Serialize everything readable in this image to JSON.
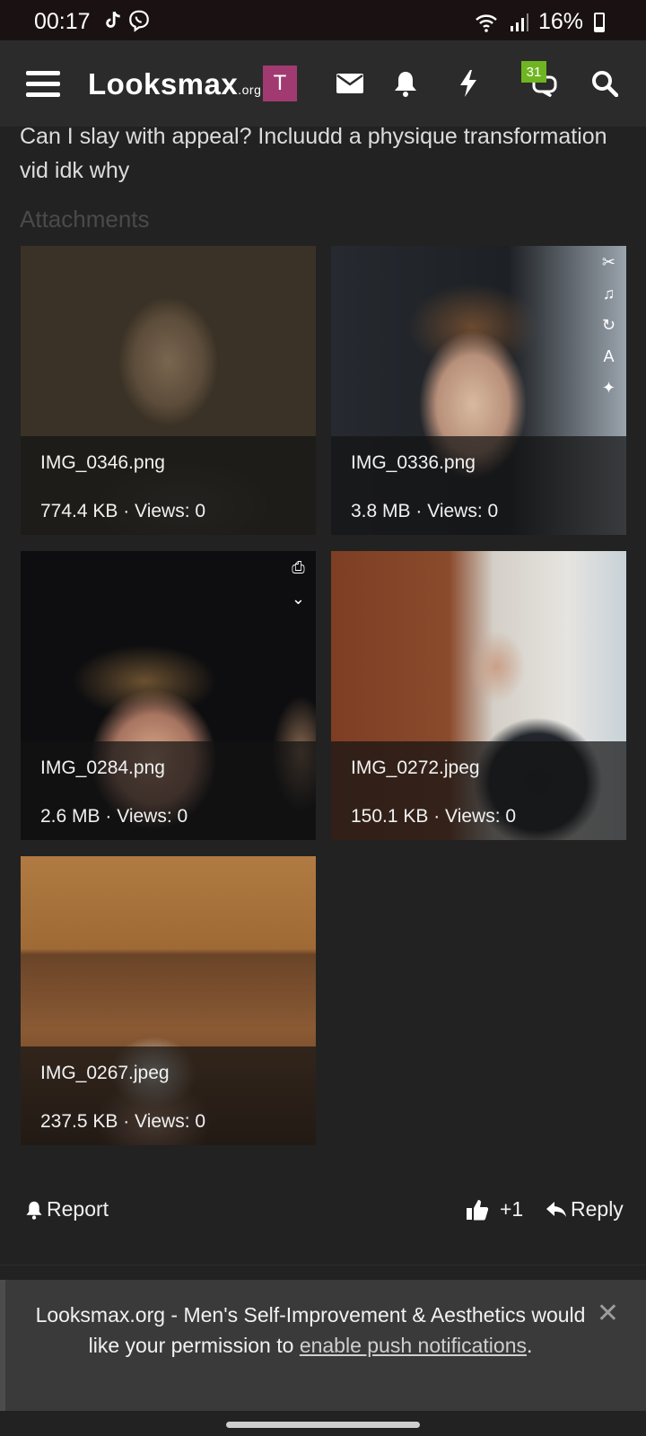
{
  "status": {
    "time": "00:17",
    "battery": "16%"
  },
  "nav": {
    "brand": "Looksmax",
    "brand_suffix": ".org",
    "avatar_letter": "T",
    "badge_count": "31"
  },
  "post": {
    "text": "Can I slay with appeal? Incluudd a physique transformation vid idk why",
    "attachments_label": "Attachments"
  },
  "attachments": [
    {
      "name": "IMG_0346.png",
      "meta": "774.4 KB · Views: 0"
    },
    {
      "name": "IMG_0336.png",
      "meta": "3.8 MB · Views: 0"
    },
    {
      "name": "IMG_0284.png",
      "meta": "2.6 MB · Views: 0"
    },
    {
      "name": "IMG_0272.jpeg",
      "meta": "150.1 KB · Views: 0"
    },
    {
      "name": "IMG_0267.jpeg",
      "meta": "237.5 KB · Views: 0"
    }
  ],
  "actions": {
    "report": "Report",
    "likes": "+1",
    "reply": "Reply"
  },
  "notification": {
    "text_before": "Looksmax.org - Men's Self-Improvement & Aesthetics would like your permission to ",
    "link": "enable push notifications",
    "text_after": "."
  }
}
